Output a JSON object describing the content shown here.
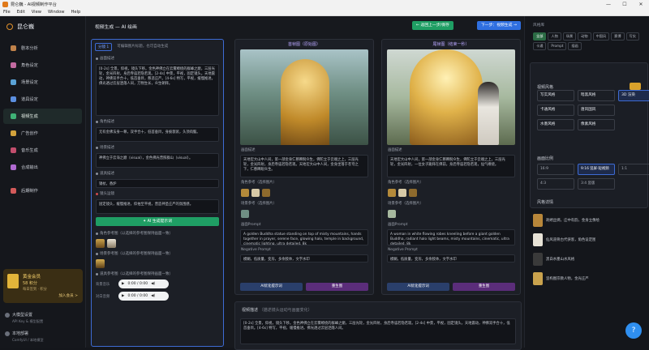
{
  "window": {
    "title": "昆仑巍 - AI视频制作平台",
    "menu": [
      "File",
      "Edit",
      "View",
      "Window",
      "Help"
    ]
  },
  "brand": {
    "name": "昆仑巍"
  },
  "nav": [
    {
      "label": "剧本分析",
      "color": "#c0824a"
    },
    {
      "label": "角色设定",
      "color": "#c26aa0"
    },
    {
      "label": "场景设定",
      "color": "#5aa2d6"
    },
    {
      "label": "道具设定",
      "color": "#5b8fe0"
    },
    {
      "label": "视频生成",
      "color": "#3fb276"
    },
    {
      "label": "广告创作",
      "color": "#d2a23c"
    },
    {
      "label": "音乐生成",
      "color": "#c24e6d"
    },
    {
      "label": "合成输出",
      "color": "#b06ad1"
    },
    {
      "label": "后期制作",
      "color": "#d35a5a"
    }
  ],
  "vip": {
    "title": "黄金会员",
    "points": "58 积分",
    "desc": "每日签到 · 积分",
    "btn": "加入会员 >"
  },
  "accounts": [
    {
      "name": "大模型设置",
      "sub": "API Key & 模型配置"
    },
    {
      "name": "本地部署",
      "sub": "ComfyUI / 本地模型"
    }
  ],
  "main": {
    "title": "视频生成 — AI 绘画",
    "btn_prev": "← 返回上一步/保存",
    "btn_next": "下一步：视频生成 →"
  },
  "left": {
    "tabs": [
      "分镜 1",
      "可编辑图片标题，也可自动生成"
    ],
    "label_desc": "画面描述",
    "desc_text": "[0-2s] 全景，仰视，镜头下移。金色神佛立在云雾缭绕的群峰之巅，三层光轮，金光四射，身后寺庙若隐若现。[2-4s] 中景，平视，固定镜头。天地震动，神佛双手合十，低首垂目，慈悲庄严。[4-6s] 特写，平视，缓慢推进。佛光透过云层洒落人间，万物生长，众生朝拜。",
    "label_role": "角色描述",
    "role_text": "无有金佛法身一尊，双手合十，低首垂目，身披袈裟，头顶肉髻。",
    "label_scene": "场景描述",
    "scene_text": "神佛立于云海之巅（visual），金色佛光普照群山（visual）。",
    "label_prop": "道具描述",
    "prop_text": "锡杖，香炉",
    "label_camera": "镜头运镜",
    "camera_text": "固定镜头，缓慢推进，仰拍至平视，营造神圣庄严的氛围感。",
    "gen_btn": "✦ AI 生成提示词",
    "label_ref1": "角色参考图（以选择的参考图保持画面一致）",
    "label_ref2": "场景参考图（以选择的参考图保持画面一致）",
    "label_ref3": "道具参考图（以选择的参考图保持画面一致）",
    "audio_label_1": "背景音乐",
    "audio_label_2": "对白音频",
    "audio_time": "0:00 / 0:00"
  },
  "cards": [
    {
      "head": "首帧图（原始图）",
      "sec": "画面描述",
      "text": "天地宏大山中人间，第一部金身仁慈睥睨众生，佛陀立于云端之上，三层光轮，金光四射，身后寺庙若隐若现。天地宏大山中人间，金身坐落于苍穹之下，仁慈睥睨众生。",
      "ref": "角色参考（选择图片）",
      "scene": "场景参考（选择图片）",
      "prompt": "画面Prompt",
      "prompt_text": "A golden Buddha statue standing on top of misty mountains, hands together in prayer, serene face, glowing halo, temple in background, cinematic lighting, ultra detailed, 8k",
      "neg": "Negative Prompt",
      "neg_text": "模糊，低质量，变形，多余肢体，文字水印",
      "b1": "AI优化提示词",
      "b2": "重生图"
    },
    {
      "head": "尾帧图（结束一秒）",
      "sec": "画面描述",
      "text": "天地宏大山中人间，第一部金身仁慈睥睨众生，佛陀立于云端之上，三层光轮，金光四射，一位女子跪拜在佛前，身后寺庙若隐若现，仙气缭绕。",
      "ref": "角色参考（选择图片）",
      "scene": "场景参考（选择图片）",
      "prompt": "画面Prompt",
      "prompt_text": "A woman in white flowing robes kneeling before a giant golden Buddha, radiant halo light beams, misty mountains, cinematic, ultra detailed, 8k",
      "neg": "Negative Prompt",
      "neg_text": "模糊，低质量，变形，多余肢体，文字水印",
      "b1": "AI优化提示词",
      "b2": "重生图"
    }
  ],
  "bottom": {
    "title": "视频描述",
    "hint": "（描述镜头运动与画面变化）",
    "text": "[0-2s] 全景，仰视，镜头下移。金色神佛立在云雾缭绕的群峰之巅，三层光轮，金光四射，身后寺庙若隐若现。[2-4s] 中景，平视，固定镜头。天地震动，神佛双手合十，低首垂目。[4-6s] 特写，平视，缓慢推进。佛光透过云层洒落人间。"
  },
  "right": {
    "title": "风格库",
    "filters": [
      "全部",
      "人物",
      "场景",
      "动物",
      "中国风",
      "赛博",
      "写实",
      "卡通",
      "Prompt",
      "插画"
    ],
    "panel_title": "视频风格",
    "styles": [
      "写实风格",
      "暗黑风格",
      "3D 渲染",
      "卡通风格",
      "唐风国风",
      "",
      "水墨风格",
      "像素风格",
      ""
    ],
    "ratio_title": "画面比例",
    "ratios": [
      "16:9",
      "9:16 竖屏·短视频",
      "1:1",
      "4:3",
      "3:4 竖版",
      ""
    ],
    "library_title": "风格详情",
    "items": [
      "刺绣丝绸，庄中有韵，金身立像绘",
      "仙风道骨古代侠客，角色设定图",
      "黑白水墨山水风格",
      "竖构图宗教人物，金光庄严"
    ]
  },
  "fab": "?"
}
